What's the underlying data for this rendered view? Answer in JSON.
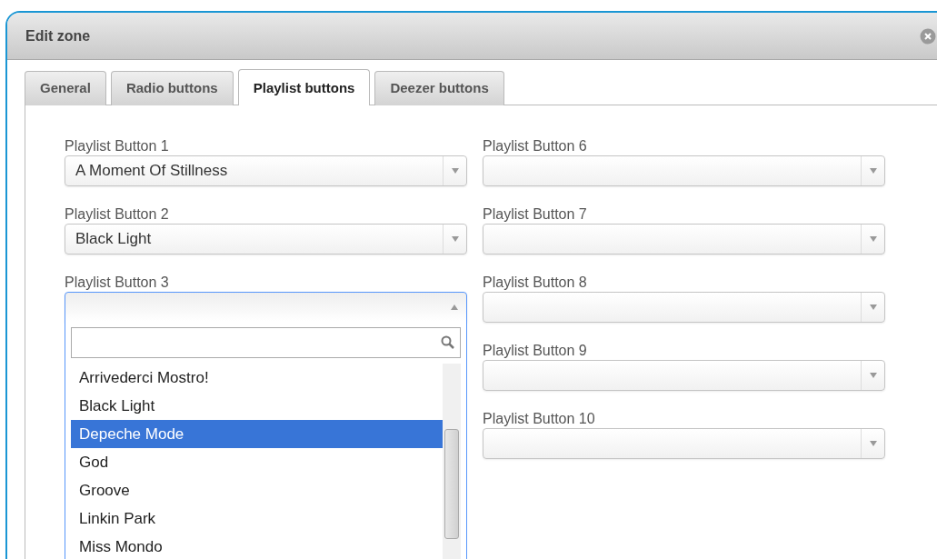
{
  "dialog": {
    "title": "Edit zone"
  },
  "tabs": [
    {
      "label": "General",
      "selected": false
    },
    {
      "label": "Radio buttons",
      "selected": false
    },
    {
      "label": "Playlist buttons",
      "selected": true
    },
    {
      "label": "Deezer buttons",
      "selected": false
    }
  ],
  "columns": [
    {
      "fields": [
        {
          "label": "Playlist Button 1",
          "value": "A Moment Of Stillness",
          "open": false
        },
        {
          "label": "Playlist Button 2",
          "value": "Black Light",
          "open": false
        },
        {
          "label": "Playlist Button 3",
          "open": true,
          "options": [
            {
              "label": "Arrivederci Mostro!",
              "selected": false
            },
            {
              "label": "Black Light",
              "selected": false
            },
            {
              "label": "Depeche Mode",
              "selected": true
            },
            {
              "label": "God",
              "selected": false
            },
            {
              "label": "Groove",
              "selected": false
            },
            {
              "label": "Linkin Park",
              "selected": false
            },
            {
              "label": "Miss Mondo",
              "selected": false
            }
          ]
        }
      ]
    },
    {
      "fields": [
        {
          "label": "Playlist Button 6",
          "open": false
        },
        {
          "label": "Playlist Button 7",
          "open": false
        },
        {
          "label": "Playlist Button 8",
          "open": false
        },
        {
          "label": "Playlist Button 9",
          "open": false
        },
        {
          "label": "Playlist Button 10",
          "open": false
        }
      ]
    }
  ]
}
